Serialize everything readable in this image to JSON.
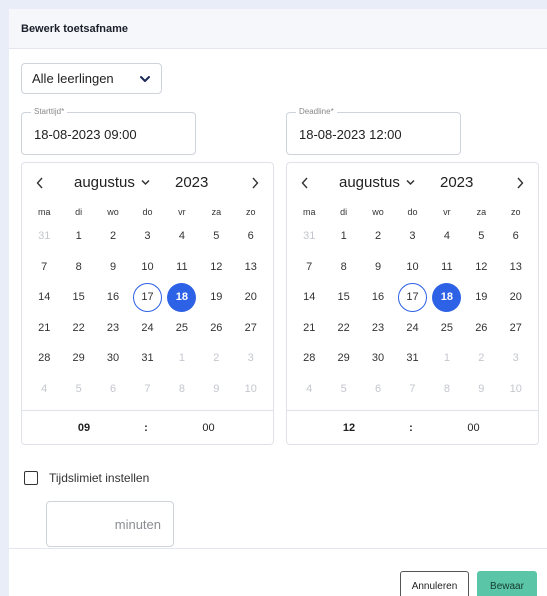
{
  "modal": {
    "title": "Bewerk toetsafname"
  },
  "filter": {
    "selected": "Alle leerlingen"
  },
  "start": {
    "legend": "Starttijd*",
    "value": "18-08-2023 09:00"
  },
  "deadline": {
    "legend": "Deadline*",
    "value": "18-08-2023 12:00"
  },
  "calendar": {
    "month": "augustus",
    "year": "2023",
    "weekdays": [
      "ma",
      "di",
      "wo",
      "do",
      "vr",
      "za",
      "zo"
    ],
    "weeks": [
      [
        {
          "d": "31",
          "m": 1
        },
        {
          "d": "1"
        },
        {
          "d": "2"
        },
        {
          "d": "3"
        },
        {
          "d": "4"
        },
        {
          "d": "5"
        },
        {
          "d": "6"
        }
      ],
      [
        {
          "d": "7"
        },
        {
          "d": "8"
        },
        {
          "d": "9"
        },
        {
          "d": "10"
        },
        {
          "d": "11"
        },
        {
          "d": "12"
        },
        {
          "d": "13"
        }
      ],
      [
        {
          "d": "14"
        },
        {
          "d": "15"
        },
        {
          "d": "16"
        },
        {
          "d": "17",
          "today": 1
        },
        {
          "d": "18",
          "sel": 1
        },
        {
          "d": "19"
        },
        {
          "d": "20"
        }
      ],
      [
        {
          "d": "21"
        },
        {
          "d": "22"
        },
        {
          "d": "23"
        },
        {
          "d": "24"
        },
        {
          "d": "25"
        },
        {
          "d": "26"
        },
        {
          "d": "27"
        }
      ],
      [
        {
          "d": "28"
        },
        {
          "d": "29"
        },
        {
          "d": "30"
        },
        {
          "d": "31"
        },
        {
          "d": "1",
          "m": 1
        },
        {
          "d": "2",
          "m": 1
        },
        {
          "d": "3",
          "m": 1
        }
      ],
      [
        {
          "d": "4",
          "m": 1
        },
        {
          "d": "5",
          "m": 1
        },
        {
          "d": "6",
          "m": 1
        },
        {
          "d": "7",
          "m": 1
        },
        {
          "d": "8",
          "m": 1
        },
        {
          "d": "9",
          "m": 1
        },
        {
          "d": "10",
          "m": 1
        }
      ]
    ],
    "start_time": {
      "hour": "09",
      "sep": ":",
      "minute": "00"
    },
    "deadline_time": {
      "hour": "12",
      "sep": ":",
      "minute": "00"
    }
  },
  "time_limit": {
    "label": "Tijdslimiet instellen",
    "checked": false,
    "unit": "minuten"
  },
  "footer": {
    "cancel_label": "Annuleren",
    "save_label": "Bewaar"
  },
  "colors": {
    "accent": "#2d62e6",
    "save": "#5bc6a7"
  }
}
